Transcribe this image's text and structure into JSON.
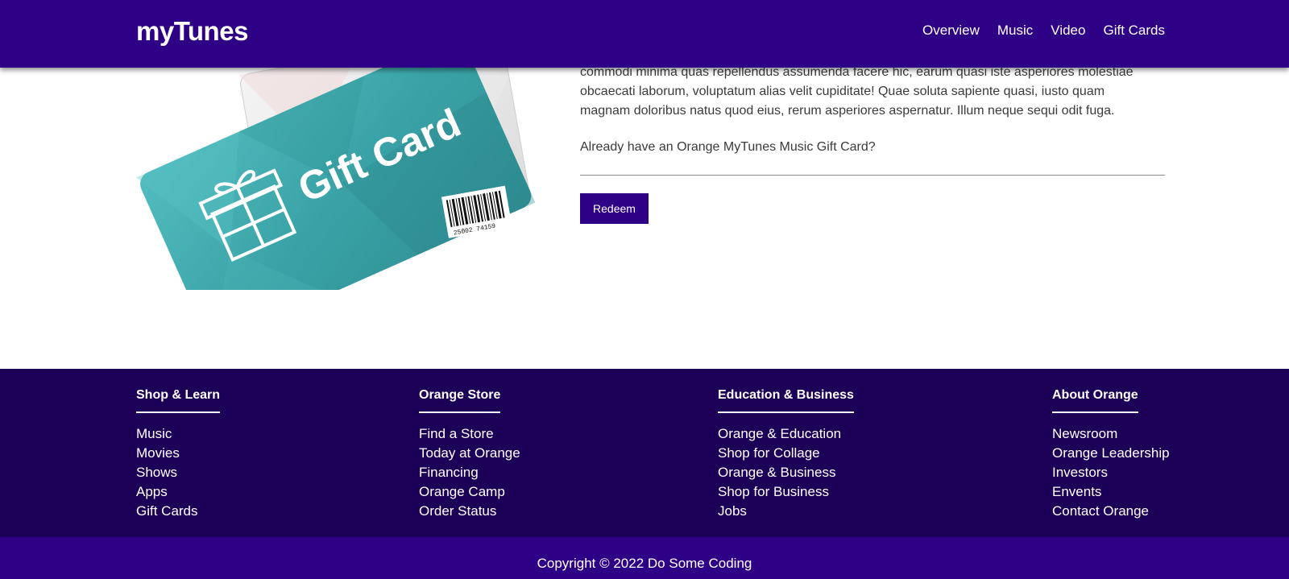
{
  "header": {
    "logo": "myTunes",
    "nav": [
      "Overview",
      "Music",
      "Video",
      "Gift Cards"
    ]
  },
  "giftcard": {
    "title": "Gift Card",
    "barcode_number": "25002 74159"
  },
  "content": {
    "paragraph_lines": [
      "commodi minima quas repellendus assumenda facere hic, earum quasi iste asperiores molestiae",
      "obcaecati laborum, voluptatum alias velit cupiditate! Quae soluta sapiente quasi, iusto quam",
      "magnam doloribus natus quod eius, rerum asperiores aspernatur. Illum neque sequi odit fuga."
    ],
    "question": "Already have an Orange MyTunes Music Gift Card?",
    "redeem_label": "Redeem"
  },
  "footer": {
    "columns": [
      {
        "title": "Shop & Learn",
        "links": [
          "Music",
          "Movies",
          "Shows",
          "Apps",
          "Gift Cards"
        ]
      },
      {
        "title": "Orange Store",
        "links": [
          "Find a Store",
          "Today at Orange",
          "Financing",
          "Orange Camp",
          "Order Status"
        ]
      },
      {
        "title": "Education & Business",
        "links": [
          "Orange & Education",
          "Shop for Collage",
          "Orange & Business",
          "Shop for Business",
          "Jobs"
        ]
      },
      {
        "title": "About Orange",
        "links": [
          "Newsroom",
          "Orange Leadership",
          "Investors",
          "Envents",
          "Contact Orange"
        ]
      }
    ],
    "copyright": "Copyright © 2022 Do Some Coding"
  },
  "colors": {
    "brand": "#2e0085",
    "footer": "#1c0057",
    "card_teal": "#3ba7ab"
  }
}
